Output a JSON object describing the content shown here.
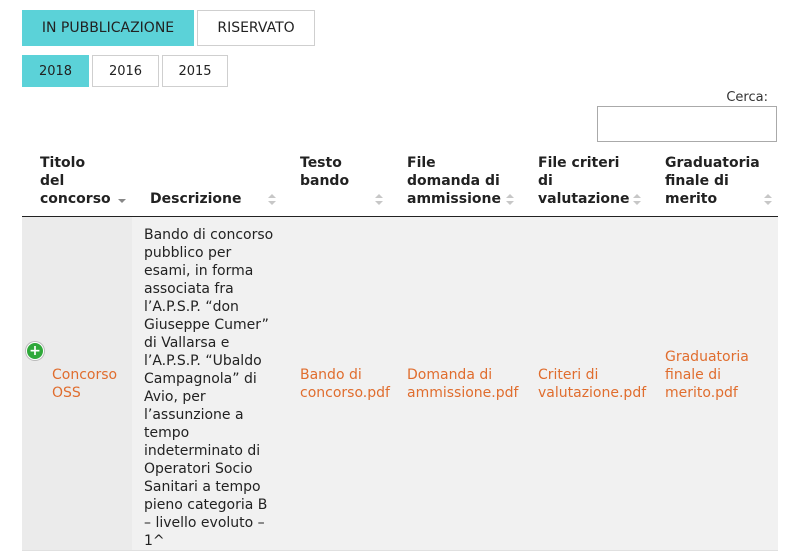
{
  "tabs": [
    {
      "label": "IN PUBBLICAZIONE",
      "active": true
    },
    {
      "label": "RISERVATO",
      "active": false
    }
  ],
  "years": [
    {
      "label": "2018",
      "active": true
    },
    {
      "label": "2016",
      "active": false
    },
    {
      "label": "2015",
      "active": false
    }
  ],
  "search": {
    "label": "Cerca:",
    "value": ""
  },
  "table": {
    "headers": [
      "Titolo del concorso",
      "Descrizione",
      "Testo bando",
      "File domanda di ammissione",
      "File criteri di valutazione",
      "Graduatoria finale di merito"
    ],
    "rows": [
      {
        "expand_icon": "plus-circle-icon",
        "title": "Concorso OSS",
        "description": "Bando di concorso pubblico per esami, in forma associata fra l’A.P.S.P. “don Giuseppe Cumer” di Vallarsa e l’A.P.S.P. “Ubaldo Campagnola” di Avio, per l’assunzione a tempo indeterminato di Operatori Socio Sanitari a tempo pieno categoria B – livello evoluto – 1^",
        "bando": "Bando di concorso.pdf",
        "domanda": "Domanda di ammissione.pdf",
        "criteri": "Criteri di valutazione.pdf",
        "graduatoria": "Graduatoria finale di merito.pdf"
      }
    ]
  },
  "colors": {
    "accent": "#5bd2d8",
    "link": "#e06d2e",
    "expand": "#2fa83a",
    "row_bg": "#f1f1f1"
  }
}
